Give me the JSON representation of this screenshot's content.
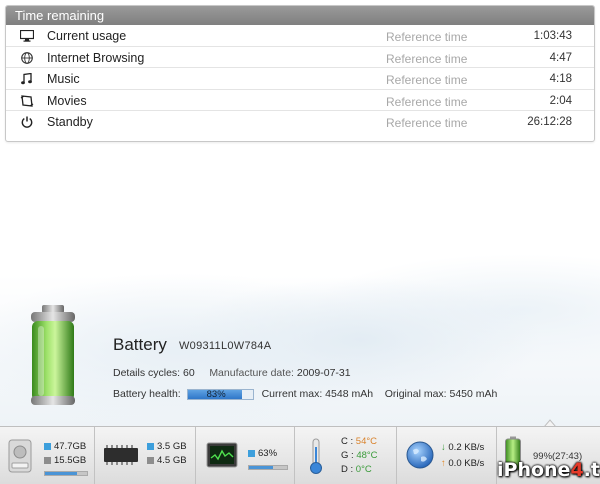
{
  "time_panel": {
    "title": "Time remaining",
    "rows": [
      {
        "icon": "monitor-icon",
        "label": "Current usage",
        "ref": "Reference time",
        "value": "1:03:43"
      },
      {
        "icon": "globe-icon",
        "label": "Internet Browsing",
        "ref": "Reference time",
        "value": "4:47"
      },
      {
        "icon": "music-note-icon",
        "label": "Music",
        "ref": "Reference time",
        "value": "4:18"
      },
      {
        "icon": "film-icon",
        "label": "Movies",
        "ref": "Reference time",
        "value": "2:04"
      },
      {
        "icon": "power-icon",
        "label": "Standby",
        "ref": "Reference time",
        "value": "26:12:28"
      }
    ]
  },
  "battery": {
    "title": "Battery",
    "serial": "W09311L0W784A",
    "cycles_label": "Details cycles:",
    "cycles_value": "60",
    "manufacture_label": "Manufacture date:",
    "manufacture_value": "2009-07-31",
    "health_label": "Battery health:",
    "health_value": "83%",
    "health_fraction": 0.83,
    "current_max_label": "Current max:",
    "current_max_value": "4548 mAh",
    "original_max_label": "Original max:",
    "original_max_value": "5450 mAh"
  },
  "status_bar": {
    "disk": {
      "used": "47.7GB",
      "free": "15.5GB",
      "fraction": 0.75
    },
    "memory": {
      "used": "3.5 GB",
      "free": "4.5 GB",
      "fraction": 0.44
    },
    "cpu": {
      "value": "63%",
      "fraction": 0.63
    },
    "temps": {
      "c_label": "C :",
      "c_value": "54°C",
      "g_label": "G :",
      "g_value": "48°C",
      "d_label": "D :",
      "d_value": "0°C"
    },
    "network": {
      "down": "0.2 KB/s",
      "up": "0.0 KB/s"
    },
    "battery": {
      "text": "99%(27:43)",
      "fraction": 0.99
    }
  },
  "watermark": {
    "prefix": "iPhone",
    "four": "4",
    "suffix": ".tw"
  },
  "colors": {
    "accent_blue": "#3d9fdc",
    "battery_green": "#5cc23a",
    "header_gray": "#8c8c8c",
    "temp_orange": "#d9822b",
    "temp_green": "#3a9b3a"
  }
}
